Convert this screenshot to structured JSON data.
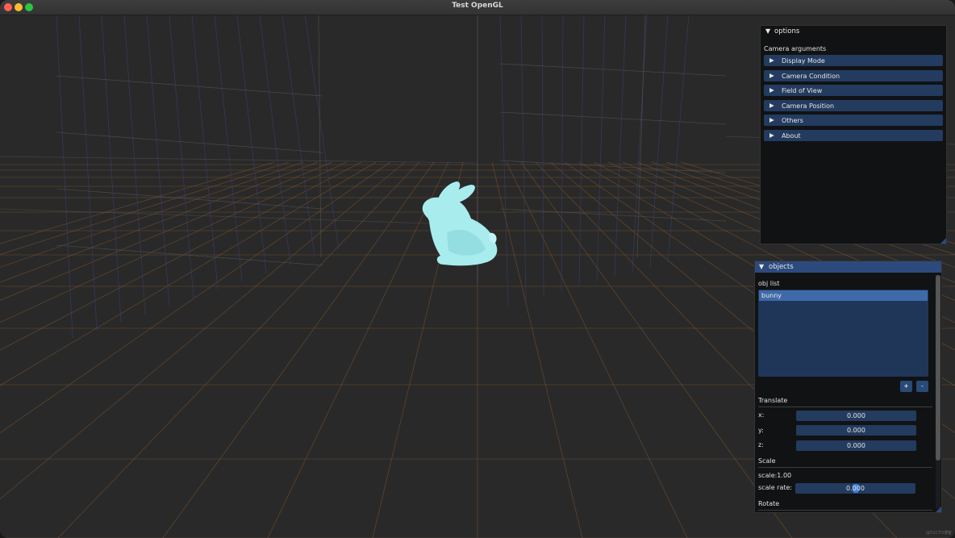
{
  "window": {
    "title": "Test OpenGL"
  },
  "options_panel": {
    "title": "options",
    "section_label": "Camera arguments",
    "items": [
      {
        "label": "Display Mode"
      },
      {
        "label": "Camera Condition"
      },
      {
        "label": "Field of View"
      },
      {
        "label": "Camera Position"
      },
      {
        "label": "Others"
      },
      {
        "label": "About"
      }
    ]
  },
  "objects_panel": {
    "title": "objects",
    "list_label": "obj list",
    "list_items": [
      "bunny"
    ],
    "add_label": "+",
    "remove_label": "-",
    "translate": {
      "label": "Translate",
      "x_label": "x:",
      "x_value": "0.000",
      "y_label": "y:",
      "y_value": "0.000",
      "z_label": "z:",
      "z_value": "0.000"
    },
    "scale": {
      "label": "Scale",
      "scale_text": "scale:1.00",
      "rate_label": "scale rate:",
      "rate_value": "0.000",
      "rate_slider_fraction": 0.5
    },
    "rotate": {
      "label": "Rotate"
    }
  },
  "viewport": {
    "model_name": "bunny",
    "model_color": "#a8ecee"
  },
  "watermark": "@51CTO博客",
  "colors": {
    "floor_grid": "#8a5a2e",
    "wall_grid_blue": "#3a3f6e",
    "wall_grid_gray": "#5a5a5a",
    "panel_accent": "#2c4a7e"
  }
}
